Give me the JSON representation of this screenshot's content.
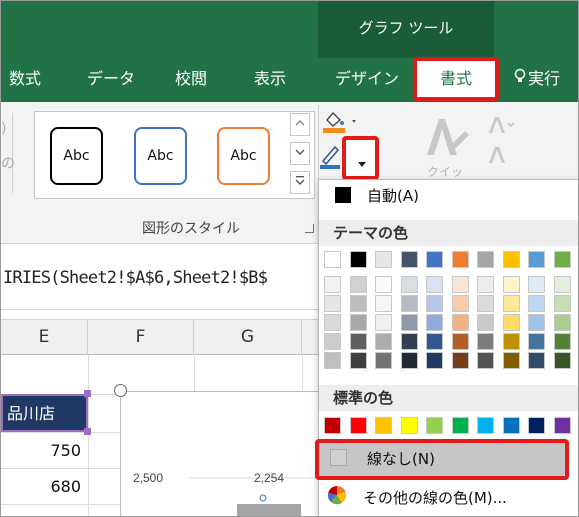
{
  "ribbon": {
    "context_label": "グラフ ツール",
    "tabs": [
      "数式",
      "データ",
      "校閲",
      "表示",
      "デザイン"
    ],
    "active_tab": "書式",
    "tell_me": "実行",
    "style_samples": [
      "Abc",
      "Abc",
      "Abc"
    ],
    "group_label": "図形のスタイル",
    "tooltip_partial": "クイック"
  },
  "formula_bar": {
    "text": "IRIES(Sheet2!$A$6,Sheet2!$B$"
  },
  "columns": [
    "E",
    "F",
    "G"
  ],
  "cells": {
    "shop": "品川店",
    "values": [
      "750",
      "680"
    ]
  },
  "chart_data": {
    "type": "bar",
    "tick_labels": [
      "2,500"
    ],
    "data_labels": [
      "2,254"
    ],
    "values": [
      2254
    ]
  },
  "menu": {
    "automatic": "自動(A)",
    "theme_header": "テーマの色",
    "standard_header": "標準の色",
    "no_line": "線なし(N)",
    "more_colors": "その他の線の色(M)...",
    "theme_top": [
      "#ffffff",
      "#000000",
      "#e7e6e6",
      "#44546a",
      "#4472c4",
      "#ed7d31",
      "#a5a5a5",
      "#ffc000",
      "#5b9bd5",
      "#70ad47"
    ],
    "standard": [
      "#c00000",
      "#ff0000",
      "#ffc000",
      "#ffff00",
      "#92d050",
      "#00b050",
      "#00b0f0",
      "#0070c0",
      "#002060",
      "#7030a0"
    ]
  },
  "colors": {
    "ribbon": "#217346",
    "highlight": "#e11a1a"
  }
}
